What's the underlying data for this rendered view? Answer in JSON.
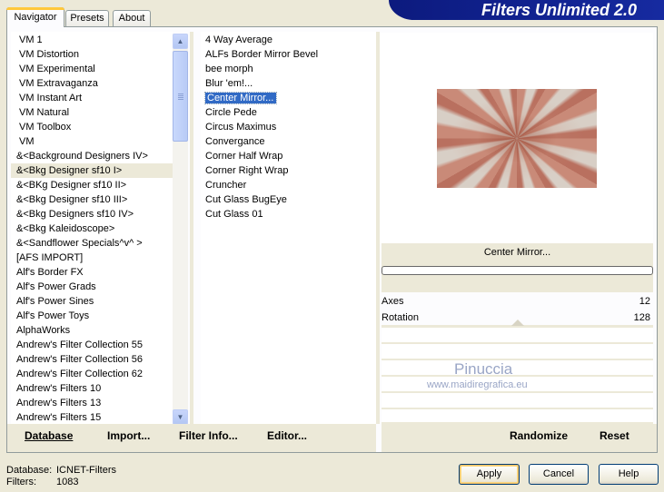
{
  "tabs": [
    "Navigator",
    "Presets",
    "About"
  ],
  "banner": "Filters Unlimited 2.0",
  "categories": [
    "VM 1",
    "VM Distortion",
    "VM Experimental",
    "VM Extravaganza",
    "VM Instant Art",
    "VM Natural",
    "VM Toolbox",
    "VM",
    "&<Background Designers IV>",
    "&<Bkg Designer sf10 I>",
    "&<BKg Designer sf10 II>",
    "&<Bkg Designer sf10 III>",
    "&<Bkg Designers sf10 IV>",
    "&<Bkg Kaleidoscope>",
    "&<Sandflower Specials^v^ >",
    "[AFS IMPORT]",
    "Alf's Border FX",
    "Alf's Power Grads",
    "Alf's Power Sines",
    "Alf's Power Toys",
    "AlphaWorks",
    "Andrew's Filter Collection 55",
    "Andrew's Filter Collection 56",
    "Andrew's Filter Collection 62",
    "Andrew's Filters 10",
    "Andrew's Filters 13",
    "Andrew's Filters 15"
  ],
  "selected_category": "&<Bkg Designer sf10 I>",
  "filters": [
    "4 Way Average",
    "ALFs Border Mirror Bevel",
    "bee morph",
    "Blur 'em!...",
    "Center Mirror...",
    "Circle Pede",
    "Circus Maximus",
    "Convergance",
    "Corner Half Wrap",
    "Corner Right Wrap",
    "Cruncher",
    "Cut Glass  BugEye",
    "Cut Glass 01"
  ],
  "selected_filter": "Center Mirror...",
  "preview": {
    "filter_name": "Center Mirror...",
    "params": [
      {
        "label": "Axes",
        "value": "12"
      },
      {
        "label": "Rotation",
        "value": "128"
      }
    ],
    "watermark_title": "Pinuccia",
    "watermark_url": "www.maidiregrafica.eu"
  },
  "panel_buttons": {
    "database": "Database",
    "import": "Import...",
    "filter_info": "Filter Info...",
    "editor": "Editor...",
    "randomize": "Randomize",
    "reset": "Reset"
  },
  "status": {
    "database_label": "Database:",
    "database_value": "ICNET-Filters",
    "filters_label": "Filters:",
    "filters_value": "1083"
  },
  "dialog_buttons": {
    "apply": "Apply",
    "cancel": "Cancel",
    "help": "Help"
  },
  "colors": {
    "banner": "#162aa0",
    "selection": "#316ac5",
    "accent_tab": "#ffc83c"
  }
}
